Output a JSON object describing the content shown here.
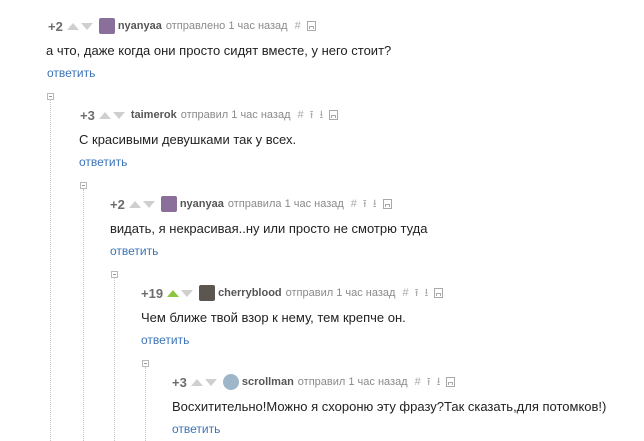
{
  "reply_label": "ответить",
  "thread": [
    {
      "rating": "+2",
      "author": "nyanyaa",
      "action": "отправлено",
      "time": "1 час назад",
      "text": "а что, даже когда они просто сидят вместе, у него стоит?",
      "upvoted": false,
      "avatar_color": "#8a6f9a",
      "tools": [
        "#",
        "save"
      ]
    },
    {
      "rating": "+3",
      "author": "taimerok",
      "action": "отправил",
      "time": "1 час назад",
      "text": "С красивыми девушками так у всех.",
      "upvoted": false,
      "avatar_color": null,
      "tools": [
        "#",
        "⭱",
        "⭳",
        "save"
      ]
    },
    {
      "rating": "+2",
      "author": "nyanyaa",
      "action": "отправила",
      "time": "1 час назад",
      "text": "видать, я некрасивая..ну или просто не смотрю туда",
      "upvoted": false,
      "avatar_color": "#8a6f9a",
      "tools": [
        "#",
        "⭱",
        "⭳",
        "save"
      ]
    },
    {
      "rating": "+19",
      "author": "cherryblood",
      "action": "отправил",
      "time": "1 час назад",
      "text": "Чем ближе твой взор к нему, тем крепче он.",
      "upvoted": true,
      "avatar_color": "#5b5650",
      "tools": [
        "#",
        "⭱",
        "⭳",
        "save"
      ]
    },
    {
      "rating": "+3",
      "author": "scrollman",
      "action": "отправил",
      "time": "1 час назад",
      "text": "Восхитительно!Можно я схороню эту фразу?Так сказать,для потомков!)",
      "upvoted": false,
      "avatar_color": "#9fb6c8",
      "tools": [
        "#",
        "⭱",
        "⭳",
        "save"
      ]
    }
  ],
  "colors": {
    "accent_link": "#3b73b6",
    "upvote_active": "#8dc63f",
    "muted": "#8a8a8a"
  }
}
